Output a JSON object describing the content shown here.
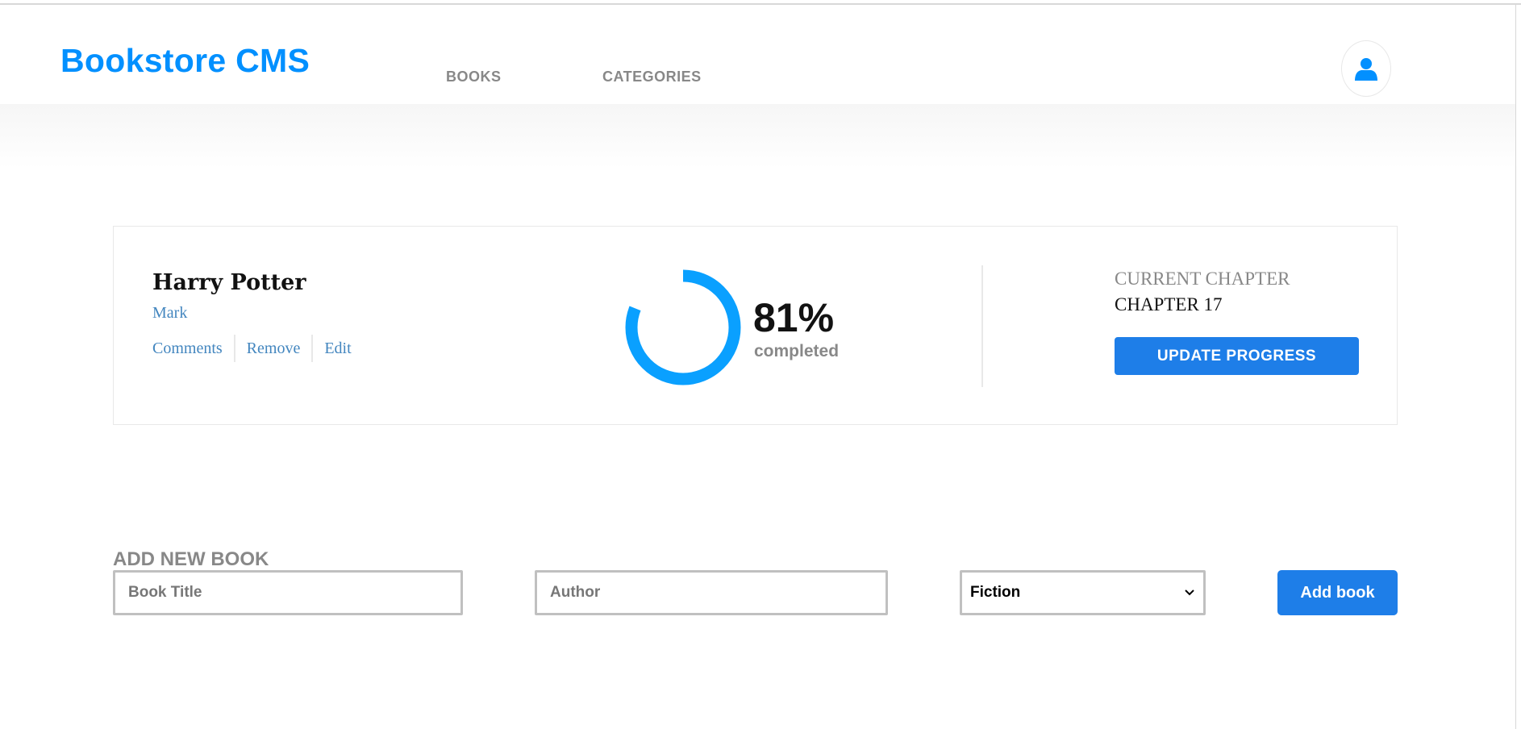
{
  "header": {
    "logo": "Bookstore CMS",
    "nav": [
      {
        "label": "BOOKS"
      },
      {
        "label": "CATEGORIES"
      }
    ],
    "user_icon": "user-icon"
  },
  "books": [
    {
      "title": "Harry Potter",
      "author": "Mark",
      "actions": [
        "Comments",
        "Remove",
        "Edit"
      ],
      "progress_percent": 81,
      "progress_label": "81%",
      "completed_label": "completed",
      "current_chapter_label": "CURRENT CHAPTER",
      "current_chapter": "CHAPTER 17",
      "update_button": "UPDATE PROGRESS"
    }
  ],
  "add_form": {
    "heading": "ADD NEW BOOK",
    "title_placeholder": "Book Title",
    "author_placeholder": "Author",
    "category_selected": "Fiction",
    "submit_label": "Add book"
  },
  "colors": {
    "brand": "#0290ff",
    "button": "#1e7ee8",
    "progress": "#0aa0ff"
  }
}
